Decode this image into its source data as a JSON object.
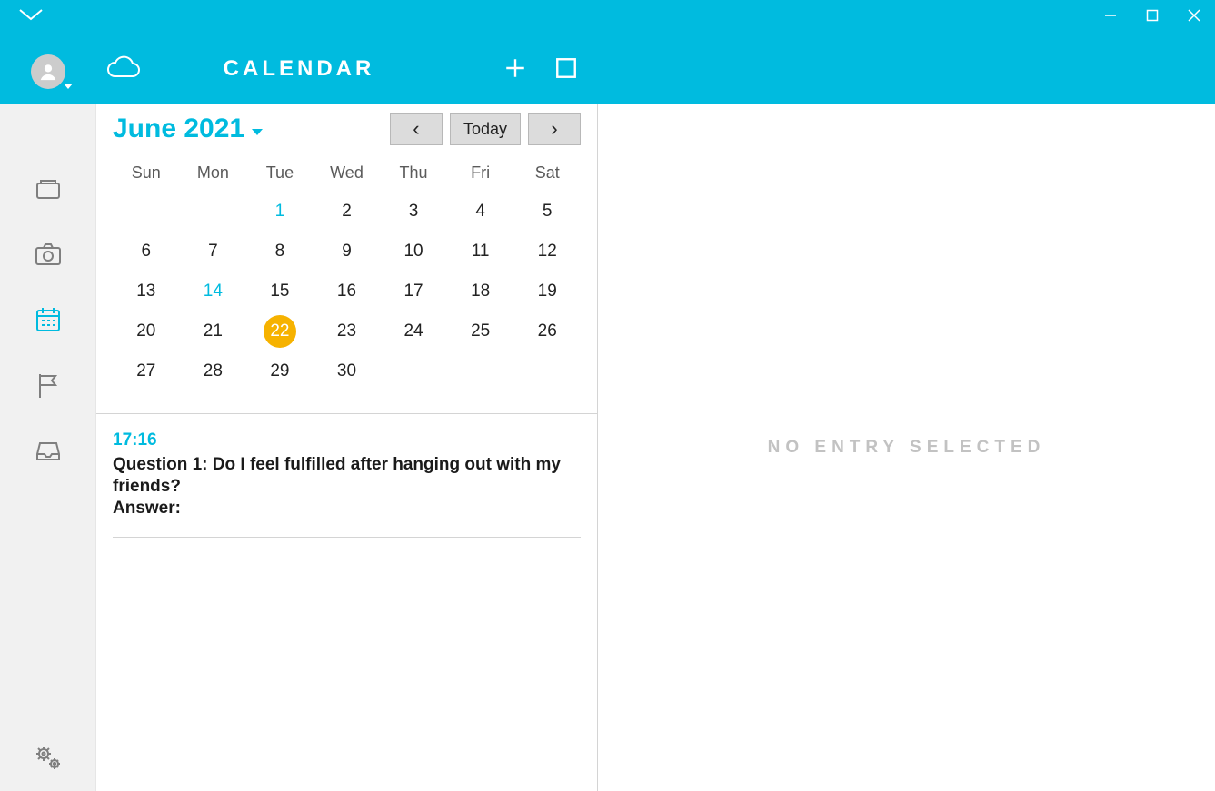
{
  "header": {
    "title": "CALENDAR"
  },
  "calendar": {
    "month_label": "June 2021",
    "nav": {
      "prev": "‹",
      "today": "Today",
      "next": "›"
    },
    "dow": [
      "Sun",
      "Mon",
      "Tue",
      "Wed",
      "Thu",
      "Fri",
      "Sat"
    ],
    "weeks": [
      [
        {
          "d": ""
        },
        {
          "d": ""
        },
        {
          "d": "1",
          "hl": true
        },
        {
          "d": "2"
        },
        {
          "d": "3"
        },
        {
          "d": "4"
        },
        {
          "d": "5"
        }
      ],
      [
        {
          "d": "6"
        },
        {
          "d": "7"
        },
        {
          "d": "8"
        },
        {
          "d": "9"
        },
        {
          "d": "10"
        },
        {
          "d": "11"
        },
        {
          "d": "12"
        }
      ],
      [
        {
          "d": "13"
        },
        {
          "d": "14",
          "hl": true
        },
        {
          "d": "15"
        },
        {
          "d": "16"
        },
        {
          "d": "17"
        },
        {
          "d": "18"
        },
        {
          "d": "19"
        }
      ],
      [
        {
          "d": "20"
        },
        {
          "d": "21"
        },
        {
          "d": "22",
          "selected": true
        },
        {
          "d": "23"
        },
        {
          "d": "24"
        },
        {
          "d": "25"
        },
        {
          "d": "26"
        }
      ],
      [
        {
          "d": "27"
        },
        {
          "d": "28"
        },
        {
          "d": "29"
        },
        {
          "d": "30"
        },
        {
          "d": ""
        },
        {
          "d": ""
        },
        {
          "d": ""
        }
      ]
    ]
  },
  "entries": [
    {
      "time": "17:16",
      "line1": "Question 1:  Do I feel fulfilled after hanging out with my friends?",
      "line2": "Answer:"
    }
  ],
  "detail": {
    "empty": "NO ENTRY SELECTED"
  }
}
